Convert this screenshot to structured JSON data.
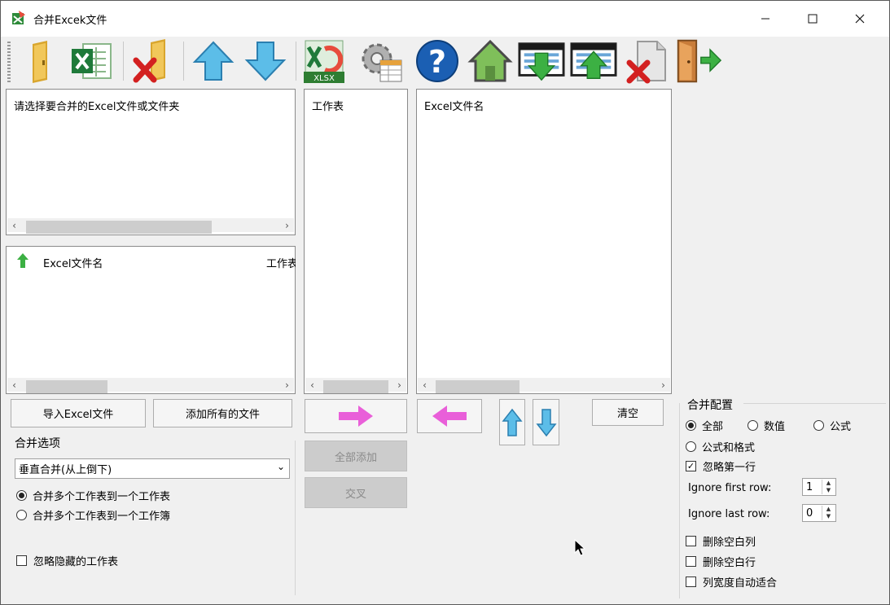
{
  "window": {
    "title": "合并Excek文件",
    "min_icon": "minimize-icon",
    "max_icon": "maximize-icon",
    "close_icon": "close-icon"
  },
  "toolbar": [
    {
      "name": "open-folder-icon"
    },
    {
      "name": "excel-file-icon"
    },
    {
      "name": "remove-folder-icon"
    },
    {
      "name": "move-up-icon"
    },
    {
      "name": "move-down-icon"
    },
    {
      "name": "xlsx-export-icon"
    },
    {
      "name": "settings-icon"
    },
    {
      "name": "help-icon"
    },
    {
      "name": "home-icon"
    },
    {
      "name": "import-list-icon"
    },
    {
      "name": "export-list-icon"
    },
    {
      "name": "delete-file-icon"
    },
    {
      "name": "exit-icon"
    }
  ],
  "file_panel": {
    "label": "请选择要合并的Excel文件或文件夹"
  },
  "list_panel": {
    "col1": "Excel文件名",
    "col2": "工作表"
  },
  "sheet_panel": {
    "label": "工作表"
  },
  "target_panel": {
    "label": "Excel文件名"
  },
  "buttons": {
    "import": "导入Excel文件",
    "add_all_files": "添加所有的文件",
    "add_all": "全部添加",
    "cross": "交叉",
    "clear": "清空"
  },
  "merge_options": {
    "title": "合并选项",
    "mode_selected": "垂直合并(从上倒下)",
    "radio1": "合并多个工作表到一个工作表",
    "radio2": "合并多个工作表到一个工作簿",
    "ignore_hidden": "忽略隐藏的工作表"
  },
  "merge_config": {
    "title": "合并配置",
    "all": "全部",
    "values": "数值",
    "formula": "公式",
    "formula_format": "公式和格式",
    "ignore_first": "忽略第一行",
    "ignore_first_row_label": "Ignore first row:",
    "ignore_first_row_value": "1",
    "ignore_last_row_label": "Ignore last row:",
    "ignore_last_row_value": "0",
    "del_empty_col": "删除空白列",
    "del_empty_row": "删除空白行",
    "autofit": "列宽度自动适合"
  },
  "colors": {
    "accent_pink": "#e95fd9",
    "arrow_blue": "#3fa8d8",
    "arrow_green": "#3cb043"
  }
}
